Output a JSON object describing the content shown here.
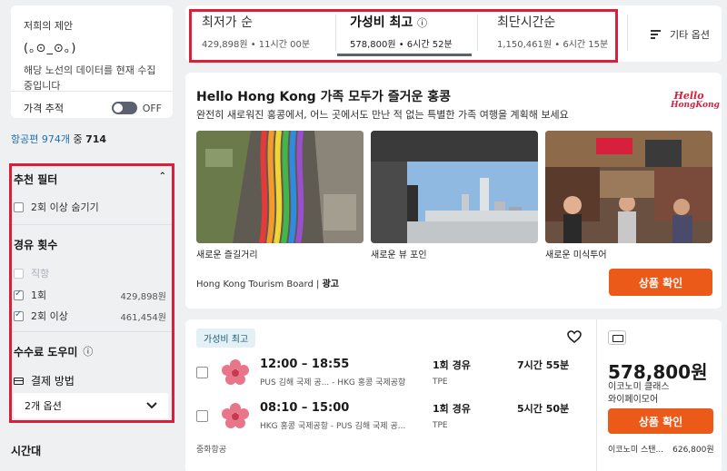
{
  "deal_card": {
    "title": "저희의 제안",
    "face": "(｡⊙_⊙｡)",
    "message": "해당 노선의 데이터를 현재 수집 중입니다",
    "track_label": "가격 추적",
    "toggle_state": "OFF"
  },
  "flight_count": {
    "link": "항공편 974개",
    "middle": " 중 ",
    "shown": "714"
  },
  "filters": {
    "recommended": {
      "heading": "추천 필터",
      "hide_two_plus": "2회 이상 숨기기"
    },
    "stops": {
      "heading": "경유 횟수",
      "options": [
        {
          "label": "직항",
          "price": "",
          "checked": false,
          "disabled": true
        },
        {
          "label": "1회",
          "price": "429,898원",
          "checked": true,
          "disabled": false
        },
        {
          "label": "2회 이상",
          "price": "461,454원",
          "checked": true,
          "disabled": false
        }
      ]
    },
    "fee_assistant": {
      "heading": "수수료 도우미",
      "info_icon": "info-icon",
      "payment_label": "결제 방법",
      "select_value": "2개 옵션"
    },
    "next_section": "시간대"
  },
  "sort_tabs": [
    {
      "title": "최저가 순",
      "sub": "429,898원 • 11시간 00분",
      "active": false
    },
    {
      "title": "가성비 최고",
      "sub": "578,800원 • 6시간 52분",
      "active": true
    },
    {
      "title": "최단시간순",
      "sub": "1,150,461원 • 6시간 15분",
      "active": false
    }
  ],
  "more_options": "기타 옵션",
  "ad": {
    "title": "Hello Hong Kong 가족 모두가 즐거운 홍콩",
    "description": "완전히 새로워진 홍콩에서, 어느 곳에서도 만난 적 없는 특별한 가족 여행을 계획해 보세요",
    "logo_text_1": "Hello",
    "logo_text_2": "HongKong",
    "images": [
      {
        "caption": "새로운 즐길거리"
      },
      {
        "caption": "새로운 뷰 포인"
      },
      {
        "caption": "새로운 미식투어"
      }
    ],
    "sponsor": "Hong Kong Tourism Board",
    "sponsor_tag": "광고",
    "cta": "상품 확인"
  },
  "flight": {
    "badge": "가성비 최고",
    "legs": [
      {
        "times": "12:00 – 18:55",
        "route": "PUS 김해 국제 공... - HKG 홍콩 국제공항",
        "stops": "1회 경유",
        "via": "TPE",
        "duration": "7시간 55분"
      },
      {
        "times": "08:10 – 15:00",
        "route": "HKG 홍콩 국제공항 - PUS 김해 국제 공...",
        "stops": "1회 경유",
        "via": "TPE",
        "duration": "5시간 50분"
      }
    ],
    "airline": "중화항공",
    "price": "578,800원",
    "price_sub_1": "이코노미 클래스",
    "price_sub_2": "와이페이모어",
    "cta": "상품 확인",
    "alt_label": "이코노미 스탠...",
    "alt_price": "626,800원"
  }
}
